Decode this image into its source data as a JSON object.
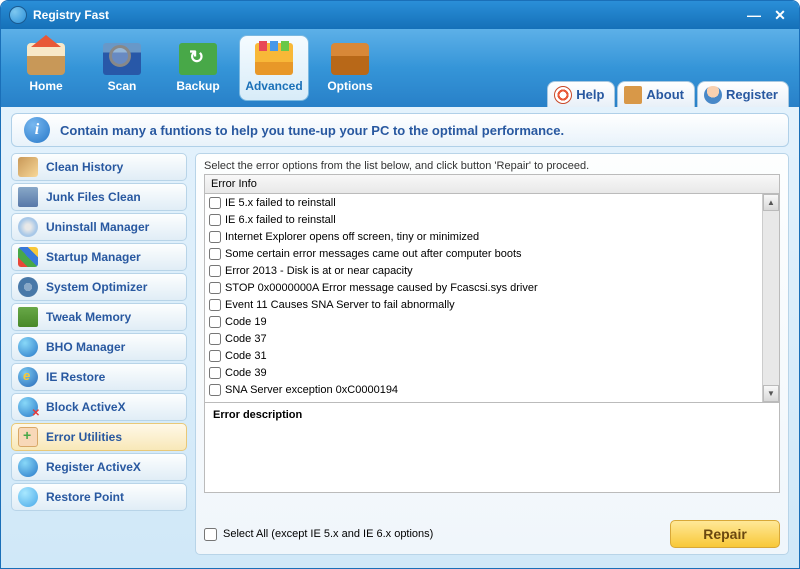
{
  "window": {
    "title": "Registry Fast"
  },
  "toolbar": {
    "home": "Home",
    "scan": "Scan",
    "backup": "Backup",
    "advanced": "Advanced",
    "options": "Options"
  },
  "right_tabs": {
    "help": "Help",
    "about": "About",
    "register": "Register"
  },
  "info_message": "Contain many a funtions to help you tune-up your PC to the optimal performance.",
  "sidebar": {
    "items": [
      {
        "label": "Clean History"
      },
      {
        "label": "Junk Files Clean"
      },
      {
        "label": "Uninstall Manager"
      },
      {
        "label": "Startup Manager"
      },
      {
        "label": "System Optimizer"
      },
      {
        "label": "Tweak Memory"
      },
      {
        "label": "BHO Manager"
      },
      {
        "label": "IE Restore"
      },
      {
        "label": "Block ActiveX"
      },
      {
        "label": "Error Utilities"
      },
      {
        "label": "Register ActiveX"
      },
      {
        "label": "Restore Point"
      }
    ]
  },
  "main": {
    "instruction": "Select the error options from the list below, and click button 'Repair' to proceed.",
    "header": "Error Info",
    "errors": [
      "IE 5.x failed to reinstall",
      "IE 6.x failed to reinstall",
      "Internet Explorer opens off screen, tiny or minimized",
      "Some certain error messages came out after computer boots",
      "Error 2013 - Disk is at or near capacity",
      "STOP 0x0000000A Error message caused by Fcascsi.sys driver",
      "Event 11 Causes SNA Server to fail abnormally",
      "Code 19",
      "Code 37",
      "Code 31",
      "Code 39",
      "SNA Server exception 0xC0000194"
    ],
    "desc_header": "Error description",
    "select_all_label": "Select All  (except IE 5.x and IE 6.x options)",
    "repair_label": "Repair"
  }
}
